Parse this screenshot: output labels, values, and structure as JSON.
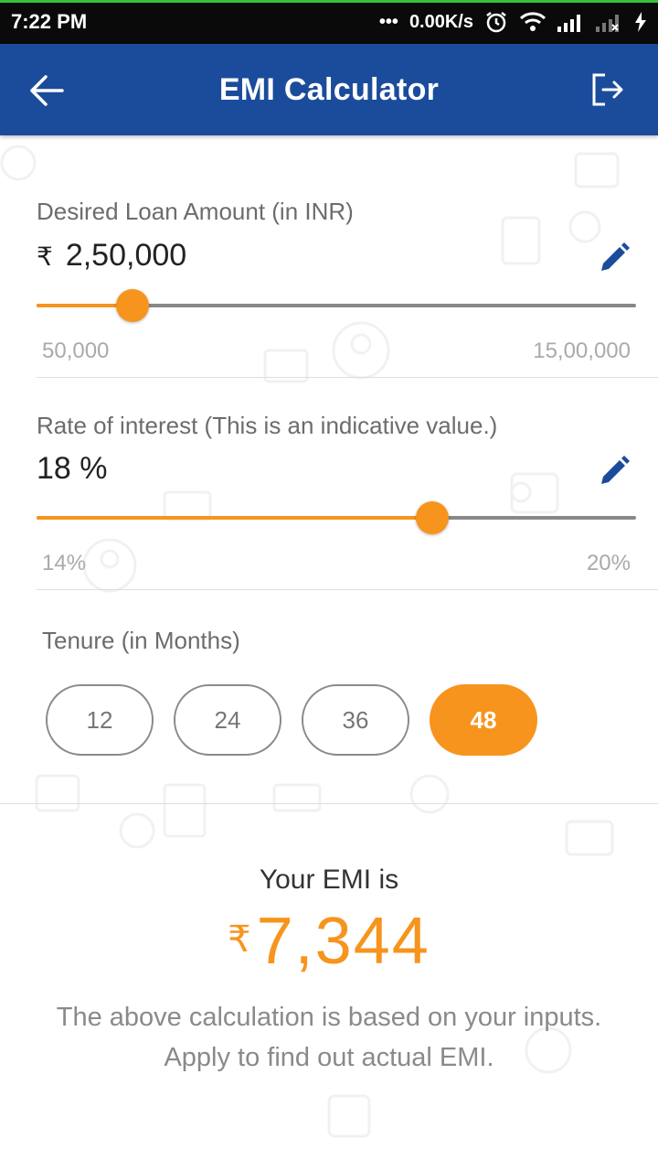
{
  "status_bar": {
    "time": "7:22 PM",
    "network_speed": "0.00K/s",
    "icons": [
      "dots-icon",
      "alarm-icon",
      "wifi-icon",
      "signal-icon",
      "signal-x-icon",
      "charging-icon"
    ]
  },
  "app_bar": {
    "title": "EMI Calculator",
    "back_icon": "back-arrow-icon",
    "exit_icon": "exit-icon"
  },
  "loan_amount": {
    "label": "Desired Loan Amount (in INR)",
    "currency_symbol": "₹",
    "value": "2,50,000",
    "min_label": "50,000",
    "max_label": "15,00,000",
    "slider_fraction": 0.16
  },
  "interest": {
    "label": "Rate of interest (This is an indicative value.)",
    "value": "18 %",
    "min_label": "14%",
    "max_label": "20%",
    "slider_fraction": 0.66
  },
  "tenure": {
    "label": "Tenure (in Months)",
    "options": [
      "12",
      "24",
      "36",
      "48"
    ],
    "selected": "48"
  },
  "result": {
    "heading": "Your EMI is",
    "currency_symbol": "₹",
    "amount": "7,344",
    "note": "The above calculation is based on your inputs. Apply to find out actual EMI."
  },
  "colors": {
    "app_bar": "#1b4c9c",
    "accent": "#f7941d",
    "status_bar": "#0a0a0a"
  }
}
